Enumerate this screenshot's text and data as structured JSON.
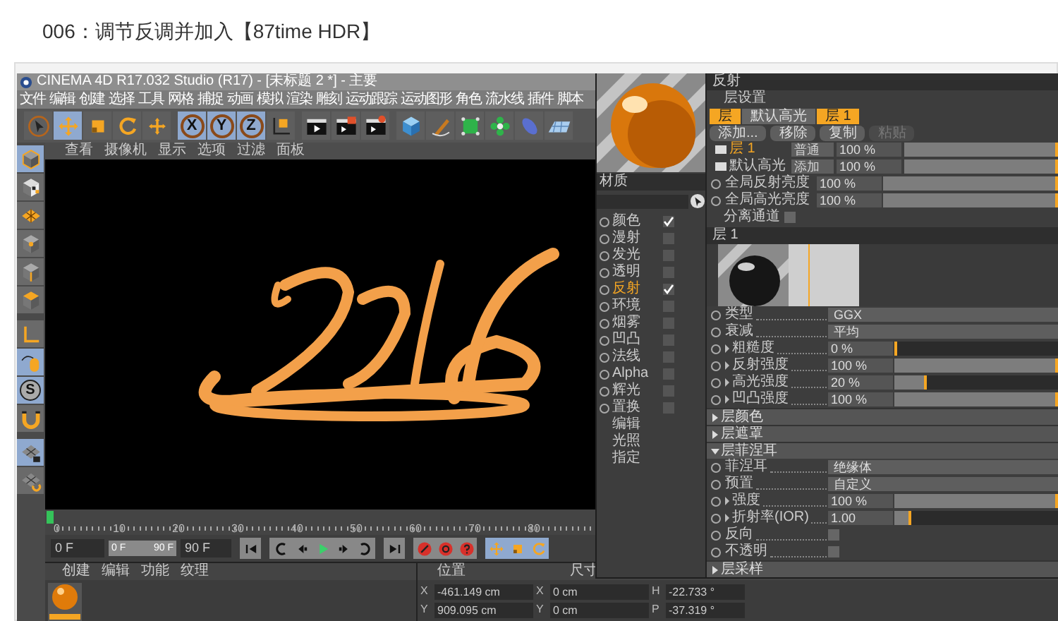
{
  "heading": "006：调节反调并加入【87time HDR】",
  "app": {
    "title": "CINEMA 4D R17.032 Studio (R17) - [未标题 2 *] - 主要",
    "menu": [
      "文件",
      "编辑",
      "创建",
      "选择",
      "工具",
      "网格",
      "捕捉",
      "动画",
      "模拟",
      "渲染",
      "雕刻",
      "运动跟踪",
      "运动图形",
      "角色",
      "流水线",
      "插件",
      "脚本"
    ],
    "toolbar": [
      {
        "kind": "select",
        "selected": false
      },
      {
        "kind": "move",
        "selected": true
      },
      {
        "kind": "scale",
        "selected": false
      },
      {
        "kind": "rotate",
        "selected": false
      },
      {
        "kind": "coords",
        "selected": false
      },
      {
        "kind": "axis",
        "label": "X",
        "selected": true
      },
      {
        "kind": "axis",
        "label": "Y",
        "selected": true
      },
      {
        "kind": "axis",
        "label": "Z",
        "selected": true
      },
      {
        "kind": "world",
        "selected": false
      },
      {
        "kind": "render-view",
        "selected": false
      },
      {
        "kind": "render",
        "selected": false
      },
      {
        "kind": "render-settings",
        "selected": false
      },
      {
        "kind": "cube",
        "selected": false
      },
      {
        "kind": "pen",
        "selected": false
      },
      {
        "kind": "cage",
        "selected": false
      },
      {
        "kind": "flower",
        "selected": false
      },
      {
        "kind": "capsule",
        "selected": false
      },
      {
        "kind": "plane",
        "selected": false
      }
    ],
    "side_tools": [
      {
        "kind": "model",
        "selected": true
      },
      {
        "kind": "texture",
        "selected": false
      },
      {
        "kind": "workplane",
        "selected": false
      },
      {
        "kind": "points",
        "selected": false
      },
      {
        "kind": "edges",
        "selected": false
      },
      {
        "kind": "polygons",
        "selected": false
      },
      {
        "kind": "axis-mode",
        "selected": false
      },
      {
        "kind": "tweak",
        "selected": true
      },
      {
        "kind": "solo",
        "label": "S",
        "selected": true
      },
      {
        "kind": "magnet",
        "selected": false
      },
      {
        "kind": "lock-grid",
        "selected": true
      },
      {
        "kind": "grid-rotate",
        "selected": false
      }
    ],
    "viewport_menu": [
      "查看",
      "摄像机",
      "显示",
      "选项",
      "过滤",
      "面板"
    ],
    "timeline": {
      "labels": [
        "0",
        "10",
        "20",
        "30",
        "40",
        "50",
        "60",
        "70",
        "80"
      ],
      "level": 0
    },
    "transport": {
      "start_field": "0 F",
      "range_start": "0 F",
      "range_end": "90 F",
      "end_field": "90 F",
      "buttons": [
        {
          "kind": "skip-start"
        },
        {
          "kind": "prev-key"
        },
        {
          "kind": "step-back"
        },
        {
          "kind": "play"
        },
        {
          "kind": "step-forward"
        },
        {
          "kind": "next-key"
        },
        {
          "kind": "skip-end"
        },
        {
          "kind": "record"
        },
        {
          "kind": "auto-key"
        },
        {
          "kind": "help"
        },
        {
          "kind": "move"
        },
        {
          "kind": "scale"
        },
        {
          "kind": "rotate"
        }
      ]
    },
    "materials": {
      "menu": [
        "创建",
        "编辑",
        "功能",
        "纹理"
      ]
    },
    "coordinates": {
      "headers": [
        "位置",
        "尺寸"
      ],
      "rows": [
        {
          "axis": "X",
          "position": "-461.149 cm",
          "size_axis": "X",
          "size": "0 cm",
          "rot_axis": "H",
          "rotation": "-22.733 °"
        },
        {
          "axis": "Y",
          "position": "909.095 cm",
          "size_axis": "Y",
          "size": "0 cm",
          "rot_axis": "P",
          "rotation": "-37.319 °"
        }
      ]
    }
  },
  "editor": {
    "name": "材质",
    "channels": [
      {
        "label": "颜色",
        "kind": "toggle",
        "checked": true,
        "selected": false
      },
      {
        "label": "漫射",
        "kind": "toggle",
        "checked": false,
        "selected": false
      },
      {
        "label": "发光",
        "kind": "toggle",
        "checked": false,
        "selected": false
      },
      {
        "label": "透明",
        "kind": "toggle",
        "checked": false,
        "selected": false
      },
      {
        "label": "反射",
        "kind": "toggle",
        "checked": true,
        "selected": true
      },
      {
        "label": "环境",
        "kind": "toggle",
        "checked": false,
        "selected": false
      },
      {
        "label": "烟雾",
        "kind": "toggle",
        "checked": false,
        "selected": false
      },
      {
        "label": "凹凸",
        "kind": "toggle",
        "checked": false,
        "selected": false
      },
      {
        "label": "法线",
        "kind": "toggle",
        "checked": false,
        "selected": false
      },
      {
        "label": "Alpha",
        "kind": "toggle",
        "checked": false,
        "selected": false
      },
      {
        "label": "辉光",
        "kind": "toggle",
        "checked": false,
        "selected": false
      },
      {
        "label": "置换",
        "kind": "toggle",
        "checked": false,
        "selected": false
      },
      {
        "label": "编辑",
        "kind": "page",
        "selected": false
      },
      {
        "label": "光照",
        "kind": "page",
        "selected": false
      },
      {
        "label": "指定",
        "kind": "page",
        "selected": false
      }
    ],
    "title": "反射",
    "layer_setup": "层设置",
    "layer_tabs": [
      {
        "label": "层",
        "selected": true
      },
      {
        "label": "默认高光",
        "selected": false
      },
      {
        "label": "层 1",
        "selected": true
      }
    ],
    "buttons": [
      {
        "label": "添加...",
        "disabled": false
      },
      {
        "label": "移除",
        "disabled": false
      },
      {
        "label": "复制",
        "disabled": false
      },
      {
        "label": "粘贴",
        "disabled": true
      }
    ],
    "layers": [
      {
        "name": "层 1",
        "selected": true,
        "mode": "普通",
        "value": "100 %",
        "level": 1
      },
      {
        "name": "默认高光",
        "selected": false,
        "mode": "添加",
        "value": "100 %",
        "level": 1
      }
    ],
    "globals": [
      {
        "label": "全局反射亮度",
        "value": "100 %",
        "level": 1
      },
      {
        "label": "全局高光亮度",
        "value": "100 %",
        "level": 1
      }
    ],
    "separate": {
      "label": "分离通道",
      "checked": false
    },
    "layer_header": "层 1",
    "rows": [
      {
        "kind": "select",
        "label": "类型",
        "value": "GGX"
      },
      {
        "kind": "select",
        "label": "衰减",
        "value": "平均"
      },
      {
        "kind": "slider",
        "label": "粗糙度",
        "value": "0 %",
        "level": 0
      },
      {
        "kind": "slider",
        "label": "反射强度",
        "value": "100 %",
        "level": 1
      },
      {
        "kind": "slider",
        "label": "高光强度",
        "value": "20 %",
        "level": 0.2
      },
      {
        "kind": "slider",
        "label": "凹凸强度",
        "value": "100 %",
        "level": 1
      },
      {
        "kind": "section",
        "label": "层颜色",
        "expanded": false
      },
      {
        "kind": "section",
        "label": "层遮罩",
        "expanded": false
      },
      {
        "kind": "section",
        "label": "层菲涅耳",
        "expanded": true
      },
      {
        "kind": "select",
        "label": "菲涅耳",
        "value": "绝缘体"
      },
      {
        "kind": "select",
        "label": "预置",
        "value": "自定义"
      },
      {
        "kind": "slider",
        "label": "强度",
        "value": "100 %",
        "level": 1
      },
      {
        "kind": "slider",
        "label": "折射率(IOR)",
        "value": "1.00",
        "level": 0.1
      },
      {
        "kind": "checkbox",
        "label": "反向",
        "checked": false
      },
      {
        "kind": "checkbox",
        "label": "不透明",
        "checked": false
      },
      {
        "kind": "section",
        "label": "层采样",
        "expanded": false
      }
    ]
  }
}
